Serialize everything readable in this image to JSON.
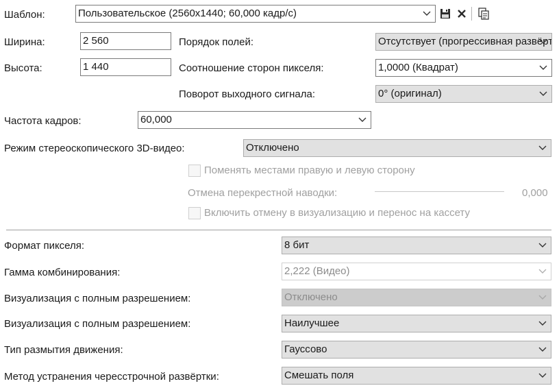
{
  "template": {
    "label": "Шаблон:",
    "value": "Пользовательское (2560x1440; 60,000 кадр/с)",
    "icons": [
      "save-icon",
      "delete-icon",
      "info-icon"
    ]
  },
  "width": {
    "label": "Ширина:",
    "value": "2 560"
  },
  "height": {
    "label": "Высота:",
    "value": "1 440"
  },
  "field_order": {
    "label": "Порядок полей:",
    "value": "Отсутствует (прогрессивная развёртка)"
  },
  "pixel_aspect": {
    "label": "Соотношение сторон пикселя:",
    "value": "1,0000 (Квадрат)"
  },
  "output_rotation": {
    "label": "Поворот выходного сигнала:",
    "value": "0° (оригинал)"
  },
  "frame_rate": {
    "label": "Частота кадров:",
    "value": "60,000"
  },
  "stereo_mode": {
    "label": "Режим стереоскопического 3D-видео:",
    "value": "Отключено"
  },
  "swap_sides": {
    "label": "Поменять местами правую и левую сторону",
    "checked": false
  },
  "crosstalk": {
    "label": "Отмена перекрестной наводки:",
    "value": "0,000"
  },
  "enable_cancel": {
    "label": "Включить отмену в визуализацию и перенос на кассету",
    "checked": false
  },
  "pixel_format": {
    "label": "Формат пикселя:",
    "value": "8 бит"
  },
  "compositing_gamma": {
    "label": "Гамма комбинирования:",
    "value": "2,222 (Видео)"
  },
  "full_res_render_1": {
    "label": "Визуализация с полным разрешением:",
    "value": "Отключено"
  },
  "full_res_render_2": {
    "label": "Визуализация с полным разрешением:",
    "value": "Наилучшее"
  },
  "motion_blur": {
    "label": "Тип размытия движения:",
    "value": "Гауссово"
  },
  "deinterlace": {
    "label": "Метод устранения чересстрочной развёртки:",
    "value": "Смешать поля"
  },
  "colors": {
    "combo_bg": "#e1e1e1",
    "disabled_text": "#a0a0a0",
    "border": "#7a7a7a"
  }
}
